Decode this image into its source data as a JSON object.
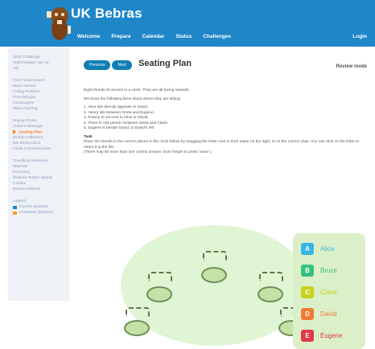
{
  "app": {
    "brand": "UK Bebras"
  },
  "header": {
    "nav": [
      "Welcome",
      "Prepare",
      "Calendar",
      "Status",
      "Challenges"
    ],
    "login": "Login"
  },
  "sidebar": {
    "groups": [
      {
        "items": [
          "2015 Challenge",
          "(Intermediate Age 12",
          "13)"
        ]
      },
      {
        "items": [
          "Find Faisal Ewan's",
          "Maze Runner",
          "Felling Problem",
          "Frost Morgan",
          "Hamburgers",
          "Maze Painting"
        ]
      },
      {
        "items": [
          "Buying Shoes",
          "Anton's Message",
          "Seating Plan",
          "Marble Collectors",
          "Not Being Liked",
          "Chain Communication"
        ]
      },
      {
        "items": [
          "Travelling Salesman",
          "Matches",
          "Recycling",
          "Modular Tender Splash",
          "Castles",
          "Beaver Network"
        ]
      }
    ],
    "active_label": "Seating Plan",
    "legend": {
      "title": "Legend",
      "items": [
        {
          "label": "Correct Question",
          "color": "#1f86c8"
        },
        {
          "label": "Answered Question",
          "color": "#ff9b28"
        }
      ]
    }
  },
  "main": {
    "prev_label": "Previous",
    "next_label": "Next",
    "title": "Seating Plan",
    "review_mode": "Review mode",
    "text": {
      "intro": "Eight friends sit around in a circle. They are all facing inwards.",
      "facts_intro": "We know the following facts about where they are sitting:",
      "facts": [
        "1. Alice sits directly opposite to David.",
        "2. Henry sits between Greta and Eugene.",
        "3. Franny is not next to Alice or David.",
        "4. There is one person between Greta and Claire.",
        "5. Eugene is beside David, to David's left."
      ],
      "task_label": "Task",
      "task_lines": [
        "Place the friends in the correct places in the circle below by dragging the letter next to their name on the right, on to the correct chair. You can click on the letter to return it to the list.",
        "(There may be more than one correct answer. Don't forget to press 'Save'.)"
      ]
    },
    "friends": [
      {
        "letter": "A",
        "name": "Alice",
        "color": "#37b6e6"
      },
      {
        "letter": "B",
        "name": "Bruce",
        "color": "#34c07f"
      },
      {
        "letter": "C",
        "name": "Claire",
        "color": "#c6d21c"
      },
      {
        "letter": "D",
        "name": "David",
        "color": "#f07a34"
      },
      {
        "letter": "E",
        "name": "Eugene",
        "color": "#e03a45"
      }
    ]
  }
}
